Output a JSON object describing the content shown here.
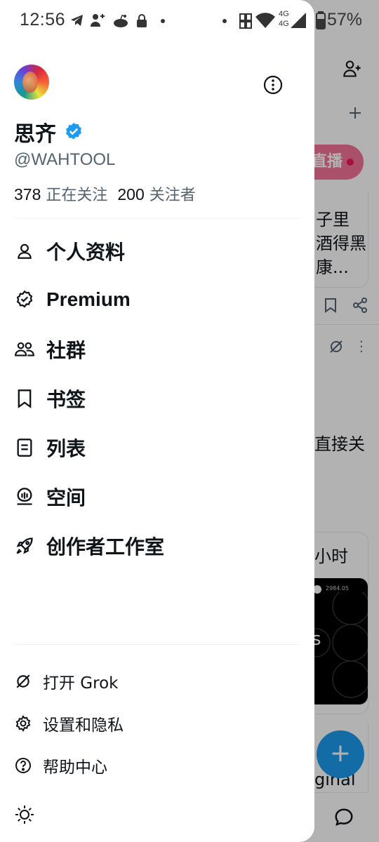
{
  "status_bar": {
    "time": "12:56",
    "network": "4G",
    "battery": "57%"
  },
  "profile": {
    "name": "思齐",
    "handle": "@WAHTOOL",
    "following_count": "378",
    "following_label": "正在关注",
    "followers_count": "200",
    "followers_label": "关注者",
    "verified": true,
    "verified_color": "#1d9bf0"
  },
  "nav": {
    "items": [
      {
        "label": "个人资料",
        "icon": "person-icon"
      },
      {
        "label": "Premium",
        "icon": "verified-badge-icon"
      },
      {
        "label": "社群",
        "icon": "communities-icon"
      },
      {
        "label": "书签",
        "icon": "bookmark-icon"
      },
      {
        "label": "列表",
        "icon": "list-icon"
      },
      {
        "label": "空间",
        "icon": "spaces-icon"
      },
      {
        "label": "创作者工作室",
        "icon": "rocket-icon"
      }
    ]
  },
  "footer": {
    "items": [
      {
        "label": "打开 Grok",
        "icon": "grok-icon"
      },
      {
        "label": "设置和隐私",
        "icon": "gear-icon"
      },
      {
        "label": "帮助中心",
        "icon": "help-icon"
      }
    ],
    "theme_icon": "sun-icon"
  },
  "background": {
    "live_label": "直播",
    "text_1": "子里",
    "text_2": "酒得黑",
    "text_3": "康...",
    "text_4": "直接关",
    "text_5": "小时",
    "text_6": "ginal",
    "price": "2984.05",
    "letter": "s",
    "accent": "#1d9bf0"
  }
}
